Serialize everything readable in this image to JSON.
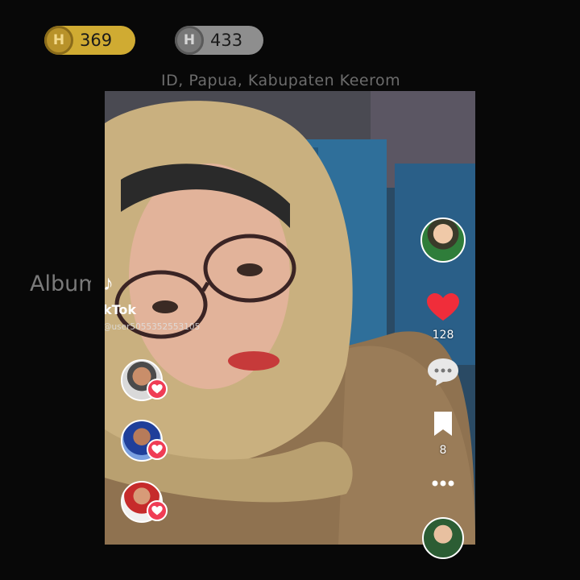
{
  "counters": [
    {
      "icon": "coin-gold-icon",
      "letter": "H",
      "value": "369",
      "color": "#d0ab32"
    },
    {
      "icon": "coin-silver-icon",
      "letter": "H",
      "value": "433",
      "color": "#8e8e8e"
    }
  ],
  "location": "ID, Papua, Kabupaten Keerom",
  "album_label": "Album",
  "video": {
    "watermark_app": "kTok",
    "watermark_user": "@user5055352553105",
    "like_count": "128",
    "save_count": "8",
    "accent_color": "#f03c55"
  }
}
